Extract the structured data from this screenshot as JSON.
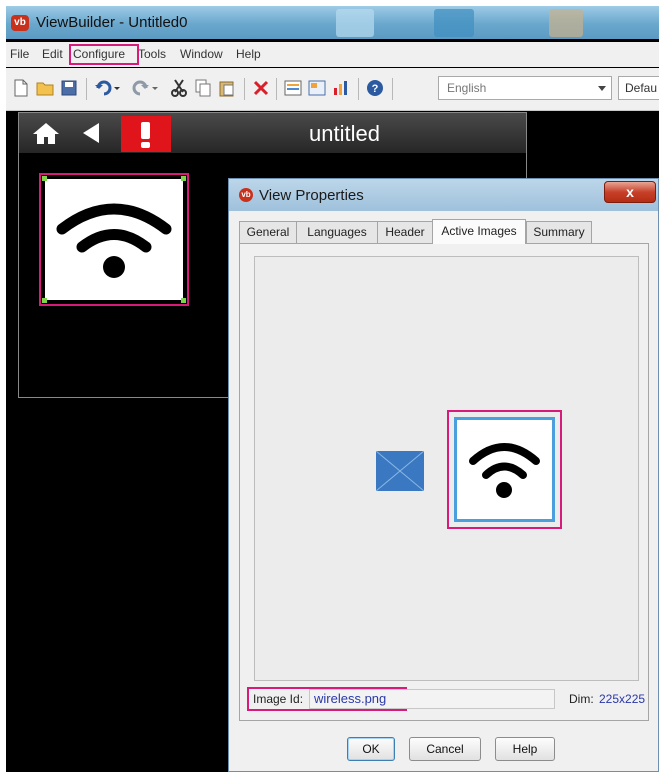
{
  "app": {
    "logo": "vb",
    "title": "ViewBuilder - Untitled0"
  },
  "menubar": {
    "items": [
      "File",
      "Edit",
      "Configure",
      "Tools",
      "Window",
      "Help"
    ],
    "highlighted": "Configure"
  },
  "toolbar": {
    "icons": [
      "new-file-icon",
      "open-folder-icon",
      "save-icon",
      "undo-icon",
      "redo-icon",
      "cut-icon",
      "copy-icon",
      "paste-icon",
      "delete-icon",
      "properties-icon",
      "edit-view-icon",
      "chart-icon",
      "help-icon"
    ],
    "language_value": "English",
    "default_value": "Defau"
  },
  "device": {
    "title": "untitled",
    "home_icon": "home-icon",
    "back_icon": "back-arrow-icon",
    "alert_icon": "alert-icon",
    "tile_icon": "wifi-icon"
  },
  "dialog": {
    "logo": "vb",
    "title": "View Properties",
    "close_label": "x",
    "tabs": [
      "General",
      "Languages",
      "Header",
      "Active Images",
      "Summary"
    ],
    "active_tab": "Active Images",
    "image_id_label": "Image Id:",
    "image_id_value": "wireless.png",
    "dim_label": "Dim:",
    "dim_value": "225x225",
    "ok_label": "OK",
    "cancel_label": "Cancel",
    "help_label": "Help"
  },
  "colors": {
    "highlight": "#d81b7a",
    "selection": "#4a9fdc",
    "alert": "#e0141b",
    "link_blue": "#2a38a8"
  }
}
